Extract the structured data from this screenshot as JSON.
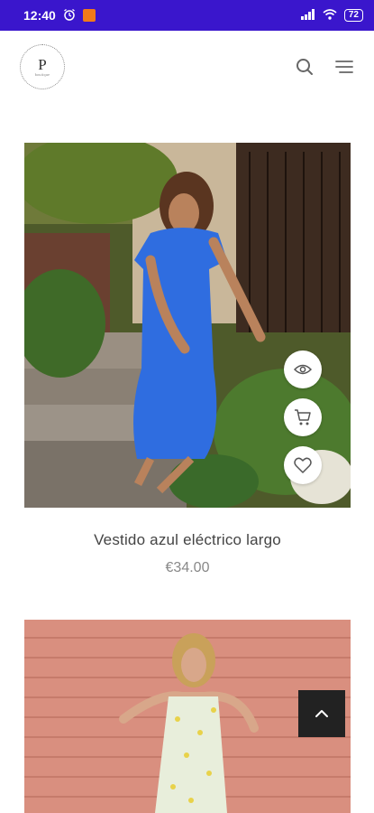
{
  "status_bar": {
    "time": "12:40",
    "battery": "72"
  },
  "header": {
    "logo_letter": "P",
    "logo_subtext": "boutique"
  },
  "products": [
    {
      "title": "Vestido azul eléctrico largo",
      "price": "€34.00"
    }
  ],
  "icons": {
    "search": "search-icon",
    "menu": "menu-icon",
    "quick_view": "eye-icon",
    "add_to_cart": "cart-icon",
    "wishlist": "heart-icon",
    "back_to_top": "chevron-up-icon"
  },
  "colors": {
    "status_bar": "#3a16cc",
    "back_to_top_bg": "#222222"
  }
}
